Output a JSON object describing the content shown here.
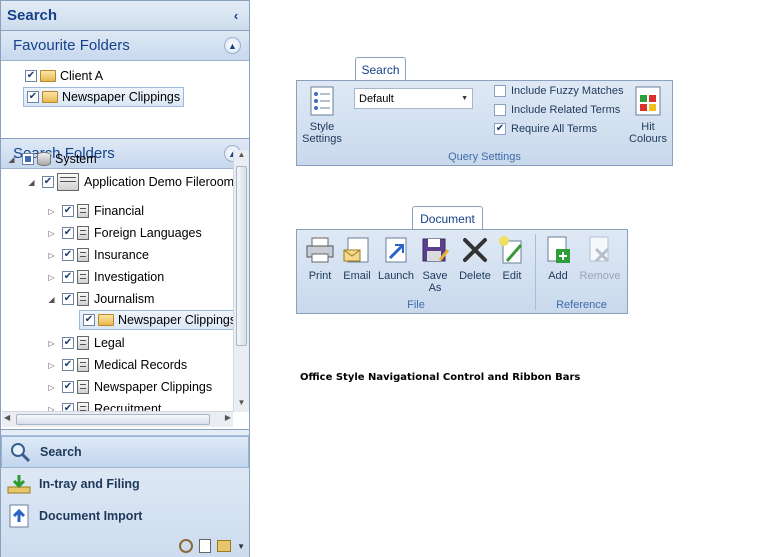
{
  "nav": {
    "title": "Search",
    "favourites": {
      "header": "Favourite Folders",
      "items": [
        {
          "label": "Client A",
          "checked": true
        },
        {
          "label": "Newspaper Clippings",
          "checked": true,
          "selected": true
        }
      ]
    },
    "search_folders": {
      "header": "Search Folders",
      "items": [
        {
          "label": "System",
          "icon": "database-icon"
        },
        {
          "label": "Application Demo Fileroom",
          "icon": "fileroom-icon"
        },
        {
          "label": "Financial",
          "icon": "cabinet-icon"
        },
        {
          "label": "Foreign Languages",
          "icon": "cabinet-icon"
        },
        {
          "label": "Insurance",
          "icon": "cabinet-icon"
        },
        {
          "label": "Investigation",
          "icon": "cabinet-icon"
        },
        {
          "label": "Journalism",
          "icon": "cabinet-icon"
        },
        {
          "label": "Newspaper Clippings",
          "icon": "folder-icon"
        },
        {
          "label": "Legal",
          "icon": "cabinet-icon"
        },
        {
          "label": "Medical Records",
          "icon": "cabinet-icon"
        },
        {
          "label": "Newspaper Clippings",
          "icon": "cabinet-icon"
        },
        {
          "label": "Recruitment",
          "icon": "cabinet-icon"
        }
      ]
    },
    "bottom": [
      {
        "label": "Search",
        "icon": "magnifier-icon"
      },
      {
        "label": "In-tray and Filing",
        "icon": "intray-icon"
      },
      {
        "label": "Document Import",
        "icon": "import-icon"
      }
    ]
  },
  "search_ribbon": {
    "tab": "Search",
    "style_settings": "Style Settings",
    "dropdown_value": "Default",
    "checks": [
      {
        "label": "Include Fuzzy Matches",
        "checked": false
      },
      {
        "label": "Include Related Terms",
        "checked": false
      },
      {
        "label": "Require All Terms",
        "checked": true
      }
    ],
    "hit_colours": "Hit Colours",
    "group": "Query Settings"
  },
  "document_ribbon": {
    "tab": "Document",
    "file_buttons": [
      "Print",
      "Email",
      "Launch",
      "Save As",
      "Delete",
      "Edit"
    ],
    "file_group": "File",
    "reference_buttons": [
      "Add",
      "Remove"
    ],
    "reference_group": "Reference"
  },
  "caption": "Office Style Navigational Control and Ribbon Bars"
}
